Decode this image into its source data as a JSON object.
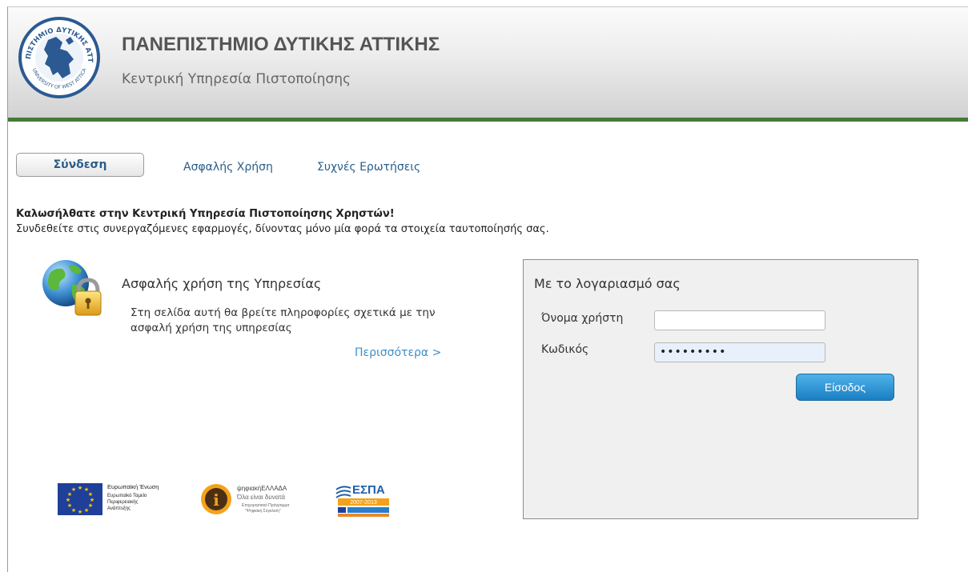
{
  "header": {
    "title": "ΠΑΝΕΠΙΣΤΗΜΙΟ ΔΥΤΙΚΗΣ ΑΤΤΙΚΗΣ",
    "subtitle": "Κεντρική Υπηρεσία Πιστοποίησης",
    "logo_icon": "university-seal-icon",
    "logo_text_top": "ΠΑΝΕΠΙΣΤΗΜΙΟ ΔΥΤΙΚΗΣ ΑΤΤΙΚΗΣ",
    "logo_text_bottom": "UNIVERSITY OF WEST ATTICA",
    "accent_color": "#447a3a"
  },
  "nav": {
    "tabs": [
      {
        "label": "Σύνδεση",
        "active": true
      },
      {
        "label": "Ασφαλής Χρήση",
        "active": false
      },
      {
        "label": "Συχνές Ερωτήσεις",
        "active": false
      }
    ]
  },
  "welcome": {
    "heading": "Καλωσήλθατε στην Κεντρική Υπηρεσία Πιστοποίησης Χρηστών!",
    "text": "Συνδεθείτε στις συνεργαζόμενες εφαρμογές, δίνοντας μόνο μία φορά τα στοιχεία ταυτοποίησής σας."
  },
  "secure_use": {
    "icon": "globe-padlock-icon",
    "title": "Ασφαλής χρήση της Υπηρεσίας",
    "text": "Στη σελίδα αυτή θα βρείτε πληροφορίες σχετικά με την ασφαλή χρήση της υπηρεσίας",
    "more_link": "Περισσότερα >"
  },
  "login": {
    "title": "Με το λογαριασμό σας",
    "username_label": "Όνομα χρήστη",
    "username_value": "",
    "password_label": "Κωδικός",
    "password_value": "•••••••••",
    "submit_label": "Είσοδος"
  },
  "footer": {
    "eu": {
      "icon": "eu-flag-icon",
      "lines": [
        "Ευρωπαϊκή Ένωση",
        "Ευρωπαϊκό Ταμείο",
        "Περιφερειακής",
        "Ανάπτυξης"
      ]
    },
    "digital": {
      "icon": "psifiaki-ellada-icon",
      "lines": [
        "ψηφιακήΕΛΛΑΔΑ",
        "Όλα είναι δυνατά",
        "Επιχειρησιακό Πρόγραμμα",
        "\"Ψηφιακή Σύγκλιση\""
      ]
    },
    "espa": {
      "icon": "espa-icon",
      "name": "ΕΣΠΑ",
      "years": "2007-2013"
    }
  }
}
